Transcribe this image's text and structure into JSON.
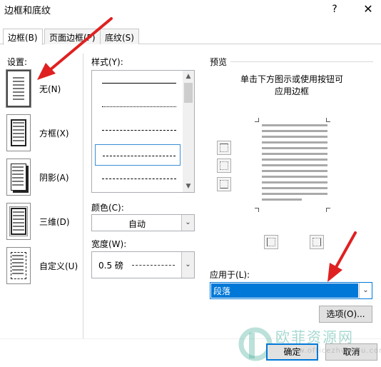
{
  "window": {
    "title": "边框和底纹",
    "help_label": "?",
    "close_label": "✕"
  },
  "tabs": [
    {
      "label": "边框(B)",
      "active": true
    },
    {
      "label": "页面边框(P)",
      "active": false
    },
    {
      "label": "底纹(S)",
      "active": false
    }
  ],
  "settings": {
    "label": "设置:",
    "items": [
      {
        "label": "无(N)",
        "icon": "none-setting-icon",
        "selected": true
      },
      {
        "label": "方框(X)",
        "icon": "box-setting-icon",
        "selected": false
      },
      {
        "label": "阴影(A)",
        "icon": "shadow-setting-icon",
        "selected": false
      },
      {
        "label": "三维(D)",
        "icon": "3d-setting-icon",
        "selected": false
      },
      {
        "label": "自定义(U)",
        "icon": "custom-setting-icon",
        "selected": false
      }
    ]
  },
  "style": {
    "label": "样式(Y):",
    "selected_index": 3
  },
  "color": {
    "label": "颜色(C):",
    "value": "自动"
  },
  "width": {
    "label": "宽度(W):",
    "value": "0.5 磅"
  },
  "preview": {
    "label": "预览",
    "hint_line1": "单击下方图示或使用按钮可",
    "hint_line2": "应用边框"
  },
  "apply_to": {
    "label": "应用于(L):",
    "value": "段落"
  },
  "buttons": {
    "options": "选项(O)...",
    "ok": "确定",
    "cancel": "取消"
  },
  "watermark": {
    "text": "欧菲资源网",
    "url": "www.officezhushou.com"
  },
  "colors": {
    "accent": "#0078d7",
    "annotation_arrow": "#e02020"
  }
}
